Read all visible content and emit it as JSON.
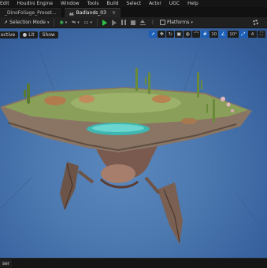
{
  "menubar": {
    "items": [
      "Edit",
      "Houdini Engine",
      "Window",
      "Tools",
      "Build",
      "Select",
      "Actor",
      "UGC",
      "Help"
    ]
  },
  "tabs": [
    {
      "label": "_DinoFoliage_Preset..."
    },
    {
      "label": "Badlands_03"
    }
  ],
  "toolbar": {
    "selection_mode": "Selection Mode",
    "platforms": "Platforms"
  },
  "viewport": {
    "perspective_label": "ective",
    "lit_label": "Lit",
    "show_label": "Show",
    "grid_snap": "10°",
    "scale_snap": "10",
    "camera_speed": "4"
  },
  "bottombar": {
    "content_drawer": "ser"
  },
  "colors": {
    "sky": "#4c79b0",
    "play": "#2ec44a",
    "highlight": "#1b5fb8",
    "water": "#3fb6b0"
  }
}
